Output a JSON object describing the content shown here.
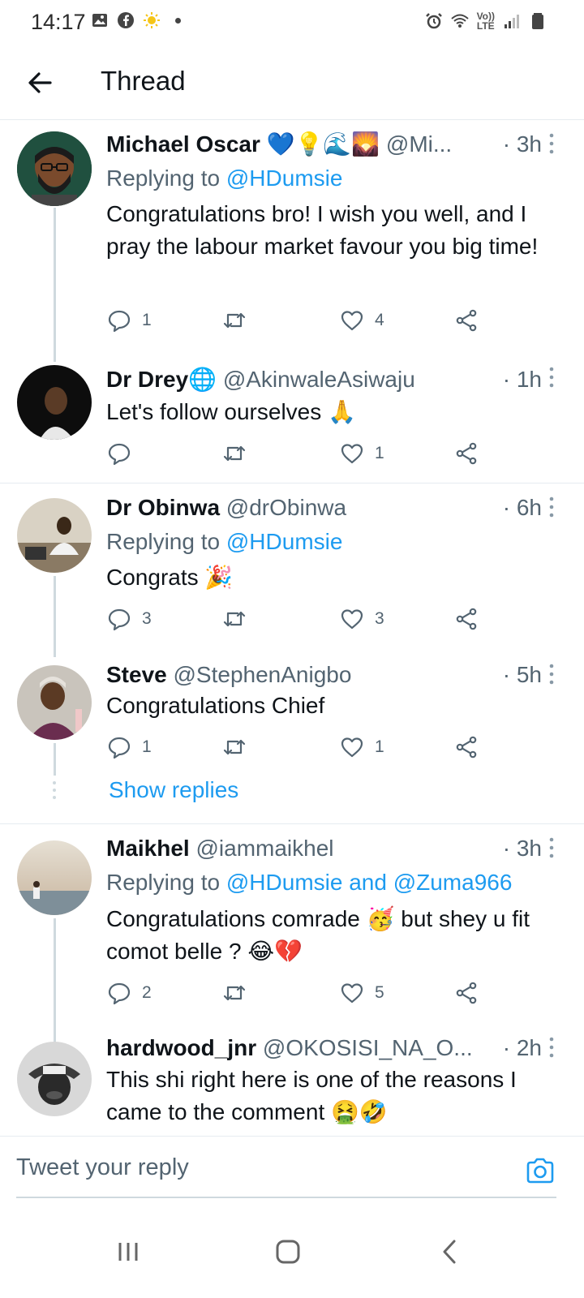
{
  "status_bar": {
    "time": "14:17",
    "left_icons": [
      "image-icon",
      "facebook-icon",
      "sun-icon",
      "dot-icon"
    ],
    "right_icons": [
      "alarm-icon",
      "wifi-icon",
      "volte-lte-icon",
      "signal-icon",
      "battery-icon"
    ],
    "lte_line1": "Vo))",
    "lte_line2": "LTE"
  },
  "header": {
    "title": "Thread"
  },
  "tweets": [
    {
      "name": "Michael Oscar",
      "name_emojis": "💙💡🌊🌄",
      "handle": "@Mi...",
      "time": "· 3h",
      "replying_prefix": "Replying to ",
      "replying_to": "@HDumsie",
      "text": "Congratulations bro! I wish you well, and I pray the labour market favour you big time!",
      "replies": "1",
      "retweets": "",
      "likes": "4"
    },
    {
      "name": "Dr Drey",
      "name_emojis": "🌐",
      "handle": "@AkinwaleAsiwaju",
      "time": "· 1h",
      "text": "Let's follow ourselves 🙏",
      "replies": "",
      "retweets": "",
      "likes": "1"
    },
    {
      "name": "Dr Obinwa",
      "handle": "@drObinwa",
      "time": "· 6h",
      "replying_prefix": "Replying to ",
      "replying_to": "@HDumsie",
      "text": "Congrats 🎉",
      "replies": "3",
      "retweets": "",
      "likes": "3"
    },
    {
      "name": "Steve",
      "handle": "@StephenAnigbo",
      "time": "· 5h",
      "text": "Congratulations Chief",
      "replies": "1",
      "retweets": "",
      "likes": "1"
    },
    {
      "name": "Maikhel",
      "handle": "@iammaikhel",
      "time": "· 3h",
      "replying_prefix": "Replying to ",
      "replying_to": "@HDumsie and @Zuma966",
      "text": "Congratulations comrade 🥳 but shey u fit comot belle ? 😂💔",
      "replies": "2",
      "retweets": "",
      "likes": "5"
    },
    {
      "name": "hardwood_jnr",
      "handle": "@OKOSISI_NA_O...",
      "time": "· 2h",
      "text": "This shi right here is one of the reasons I came to the comment 🤮🤣"
    }
  ],
  "show_replies": "Show replies",
  "reply_bar": {
    "placeholder": "Tweet your reply"
  },
  "nav_bar": {
    "buttons": [
      "recent-apps-button",
      "home-button",
      "back-nav-button"
    ]
  },
  "colors": {
    "accent": "#1d9bf0",
    "text": "#0f1419",
    "secondary": "#536471",
    "divider": "#e6ecf0"
  }
}
